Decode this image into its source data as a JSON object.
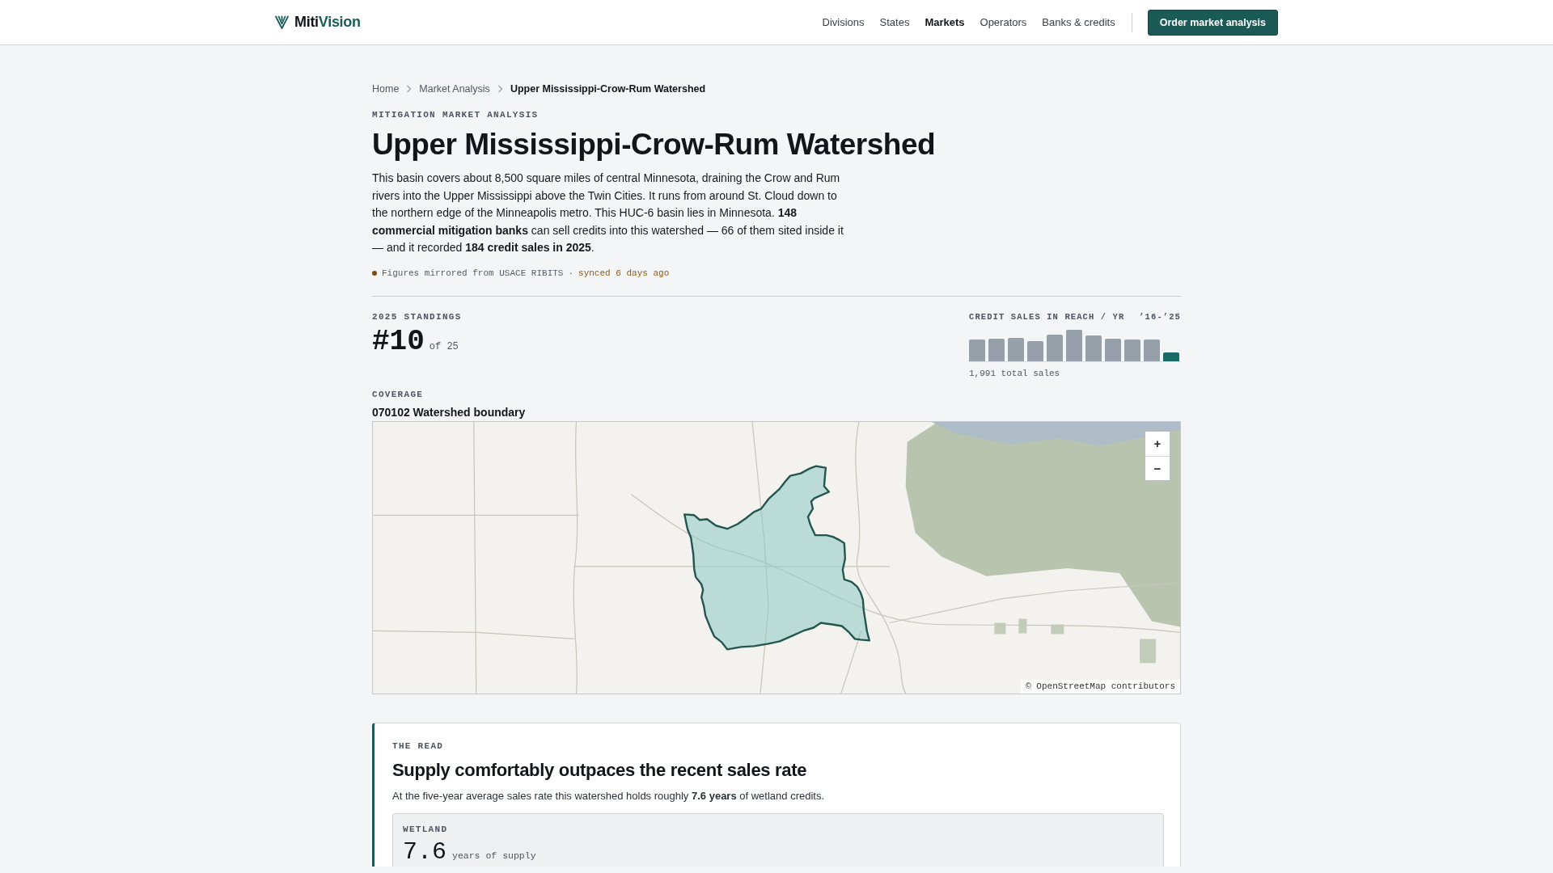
{
  "nav": {
    "brand": {
      "dark_part": "Miti",
      "accent_part": "Vision"
    },
    "links": [
      {
        "label": "Divisions",
        "selected": false
      },
      {
        "label": "States",
        "selected": false
      },
      {
        "label": "Markets",
        "selected": true
      },
      {
        "label": "Operators",
        "selected": false
      },
      {
        "label": "Banks & credits",
        "selected": false
      }
    ],
    "cta": "Order market analysis"
  },
  "breadcrumb": [
    {
      "label": "Home",
      "current": false
    },
    {
      "label": "Market Analysis",
      "current": false
    },
    {
      "label": "Upper Mississippi-Crow-Rum Watershed",
      "current": true
    }
  ],
  "eyebrow": "MITIGATION MARKET ANALYSIS",
  "title": "Upper Mississippi-Crow-Rum Watershed",
  "intro": "This basin covers about 8,500 square miles of central Minnesota, draining the Crow and Rum rivers into the Upper Mississippi above the Twin Cities. It runs from around St. Cloud down to the northern edge of the Minneapolis metro. This HUC-6 basin lies in Minnesota. **148 commercial mitigation banks** can sell credits into this watershed — 66 of them sited inside it — and it recorded **184 credit sales in 2025**.",
  "source": {
    "text": "Figures mirrored from USACE RIBITS",
    "separator": "·",
    "synced": "synced 6 days ago"
  },
  "standings": {
    "label": "2025 STANDINGS",
    "rank": "#10",
    "total": "of 25"
  },
  "sales_sparkline": {
    "title": "CREDIT SALES IN REACH / YR",
    "range": "’16-’25",
    "total": "1,991 total sales"
  },
  "coverage": {
    "label": "COVERAGE",
    "name": "070102 Watershed boundary",
    "map": {
      "zoom_in": "+",
      "zoom_out": "−",
      "attribution": "© OpenStreetMap contributors"
    }
  },
  "read": {
    "eyebrow": "THE READ",
    "heading": "Supply comfortably outpaces the recent sales rate",
    "text": "At the five-year average sales rate this watershed holds roughly **7.6 years** of wetland credits.",
    "supply": [
      {
        "label": "WETLAND",
        "value": "7.6",
        "unit": "years of supply"
      }
    ]
  }
}
